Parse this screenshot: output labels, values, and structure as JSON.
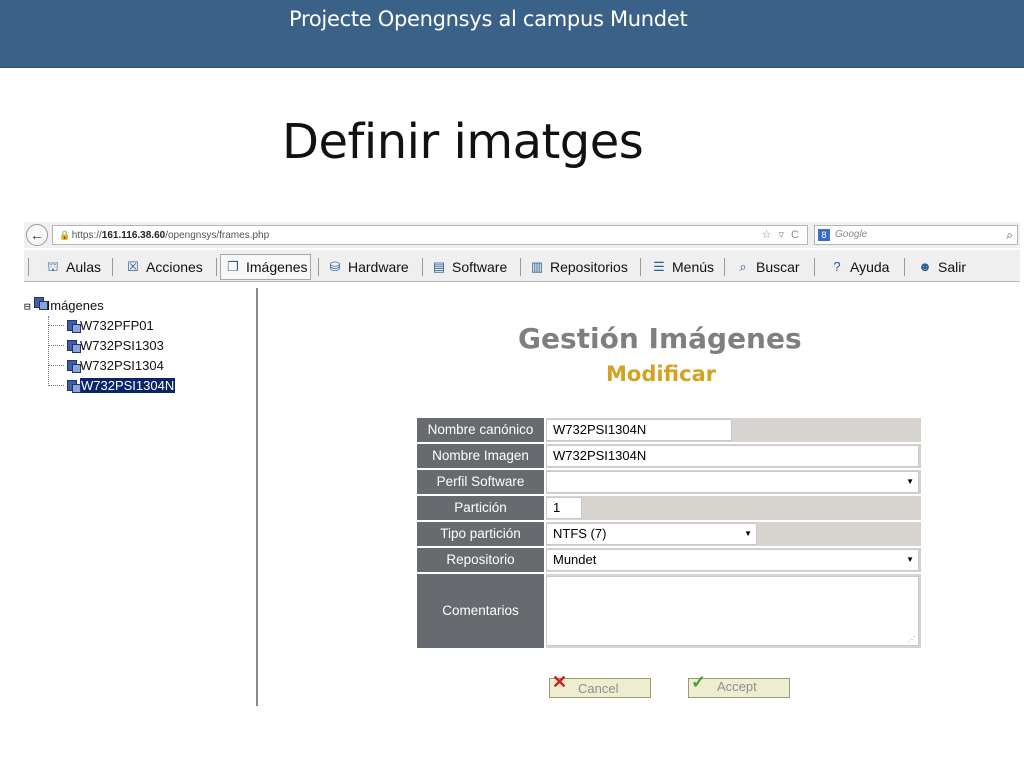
{
  "slide": {
    "banner_title": "Projecte Opengnsys al campus Mundet",
    "title": "Definir imatges"
  },
  "browser": {
    "url_prefix": "https://",
    "url_host": "161.116.38.60",
    "url_path": "/opengnsys/frames.php",
    "search_placeholder": "Google"
  },
  "menu": {
    "items": [
      {
        "label": "Aulas",
        "icon": "classroom-icon"
      },
      {
        "label": "Acciones",
        "icon": "actions-icon"
      },
      {
        "label": "Imágenes",
        "icon": "images-icon"
      },
      {
        "label": "Hardware",
        "icon": "hardware-icon"
      },
      {
        "label": "Software",
        "icon": "software-icon"
      },
      {
        "label": "Repositorios",
        "icon": "repository-icon"
      },
      {
        "label": "Menús",
        "icon": "menu-icon"
      },
      {
        "label": "Buscar",
        "icon": "search-icon"
      },
      {
        "label": "Ayuda",
        "icon": "help-icon"
      },
      {
        "label": "Salir",
        "icon": "exit-icon"
      }
    ],
    "active": "Imágenes"
  },
  "tree": {
    "root": "Imágenes",
    "items": [
      "W732PFP01",
      "W732PSI1303",
      "W732PSI1304",
      "W732PSI1304N"
    ],
    "selected": "W732PSI1304N"
  },
  "content": {
    "title": "Gestión Imágenes",
    "subtitle": "Modificar"
  },
  "form": {
    "fields": [
      {
        "label": "Nombre canónico",
        "value": "W732PSI1304N"
      },
      {
        "label": "Nombre Imagen",
        "value": "W732PSI1304N"
      },
      {
        "label": "Perfil Software",
        "value": ""
      },
      {
        "label": "Partición",
        "value": "1"
      },
      {
        "label": "Tipo partición",
        "value": "NTFS (7)"
      },
      {
        "label": "Repositorio",
        "value": "Mundet"
      },
      {
        "label": "Comentarios",
        "value": ""
      }
    ],
    "cancel_label": "Cancel",
    "accept_label": "Accept"
  },
  "colors": {
    "banner": "#3a6187",
    "label_bg": "#676a6f",
    "title_gray": "#7f7f7f",
    "subtitle_gold": "#d4a121"
  }
}
